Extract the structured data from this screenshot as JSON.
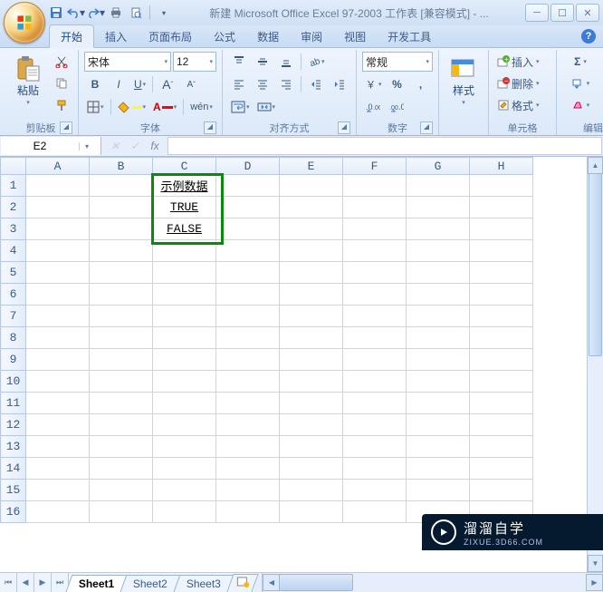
{
  "title": "新建 Microsoft Office Excel 97-2003 工作表 [兼容模式] - ...",
  "ribbon": {
    "tabs": [
      "开始",
      "插入",
      "页面布局",
      "公式",
      "数据",
      "审阅",
      "视图",
      "开发工具"
    ],
    "active_tab": 0,
    "groups": {
      "clipboard": {
        "label": "剪贴板",
        "paste": "粘贴"
      },
      "font": {
        "label": "字体",
        "name": "宋体",
        "size": "12",
        "bold": "B",
        "italic": "I",
        "underline": "U",
        "grow": "A",
        "shrink": "A",
        "border_icon": "borders-icon",
        "fill_icon": "fill-icon",
        "color_icon": "font-color-icon",
        "phonetic": "wén"
      },
      "alignment": {
        "label": "对齐方式"
      },
      "number": {
        "label": "数字",
        "format": "常规",
        "percent": "%",
        "comma": ","
      },
      "styles": {
        "label": "样式"
      },
      "cells": {
        "label": "单元格",
        "insert": "插入",
        "delete": "删除",
        "format": "格式"
      },
      "editing": {
        "label": "编辑",
        "sigma": "Σ"
      }
    }
  },
  "name_box": "E2",
  "formula_fx": "fx",
  "columns": [
    "A",
    "B",
    "C",
    "D",
    "E",
    "F",
    "G",
    "H"
  ],
  "rows": [
    1,
    2,
    3,
    4,
    5,
    6,
    7,
    8,
    9,
    10,
    11,
    12,
    13,
    14,
    15,
    16
  ],
  "cell_data": {
    "C1": "示例数据",
    "C2": "TRUE",
    "C3": "FALSE"
  },
  "sheets": [
    "Sheet1",
    "Sheet2",
    "Sheet3"
  ],
  "active_sheet": 0,
  "watermark": {
    "brand": "溜溜自学",
    "url": "ZIXUE.3D66.COM"
  }
}
